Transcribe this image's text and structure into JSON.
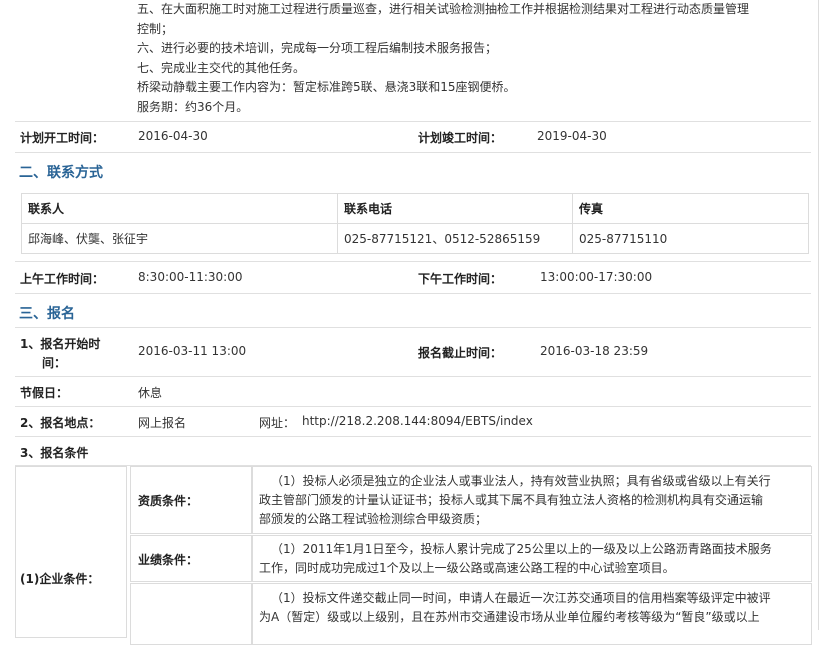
{
  "intro_lines": [
    "五、在大面积施工时对施工过程进行质量巡查，进行相关试验检测抽检工作并根据检测结果对工程进行动态质量管理",
    "控制；",
    "六、进行必要的技术培训，完成每一分项工程后编制技术服务报告；",
    "七、完成业主交代的其他任务。",
    "桥梁动静载主要工作内容为：暂定标准跨5联、悬浇3联和15座钢便桥。",
    "服务期：约36个月。"
  ],
  "plan": {
    "start_label": "计划开工时间：",
    "start_value": "2016-04-30",
    "end_label": "计划竣工时间：",
    "end_value": "2019-04-30"
  },
  "contact": {
    "title": "二、联系方式",
    "headers": [
      "联系人",
      "联系电话",
      "传真"
    ],
    "row": [
      "邱海峰、伏龑、张征宇",
      "025-87715121、0512-52865159",
      "025-87715110"
    ]
  },
  "hours": {
    "am_label": "上午工作时间：",
    "am_value": "8:30:00-11:30:00",
    "pm_label": "下午工作时间：",
    "pm_value": "13:00:00-17:30:00"
  },
  "signup": {
    "title": "三、报名",
    "start_label_1": "1、报名开始时",
    "start_label_2": "间：",
    "start_value": "2016-03-11 13:00",
    "end_label": "报名截止时间：",
    "end_value": "2016-03-18 23:59",
    "holiday_label": "节假日：",
    "holiday_value": "休息",
    "place_label": "2、报名地点：",
    "place_value": "网上报名",
    "url_label": "网址：",
    "url_value": "http://218.2.208.144:8094/EBTS/index",
    "cond_label": "3、报名条件"
  },
  "enterprise": {
    "label": "(1)企业条件：",
    "qual_label": "资质条件：",
    "qual_text_1": "（1）投标人必须是独立的企业法人或事业法人，持有效营业执照；具有省级或省级以上有关行",
    "qual_text_2": "政主管部门颁发的计量认证证书；投标人或其下属不具有独立法人资格的检测机构具有交通运输",
    "qual_text_3": "部颁发的公路工程试验检测综合甲级资质；",
    "perf_label": "业绩条件：",
    "perf_text_1": "（1）2011年1月1日至今，投标人累计完成了25公里以上的一级及以上公路沥青路面技术服务",
    "perf_text_2": "工作，同时成功完成过1个及以上一级公路或高速公路工程的中心试验室项目。",
    "credit_text_1": "（1）投标文件递交截止同一时间，申请人在最近一次江苏交通项目的信用档案等级评定中被评",
    "credit_text_2": "为A（暂定）级或以上级别，且在苏州市交通建设市场从业单位履约考核等级为“暂良”级或以上"
  }
}
